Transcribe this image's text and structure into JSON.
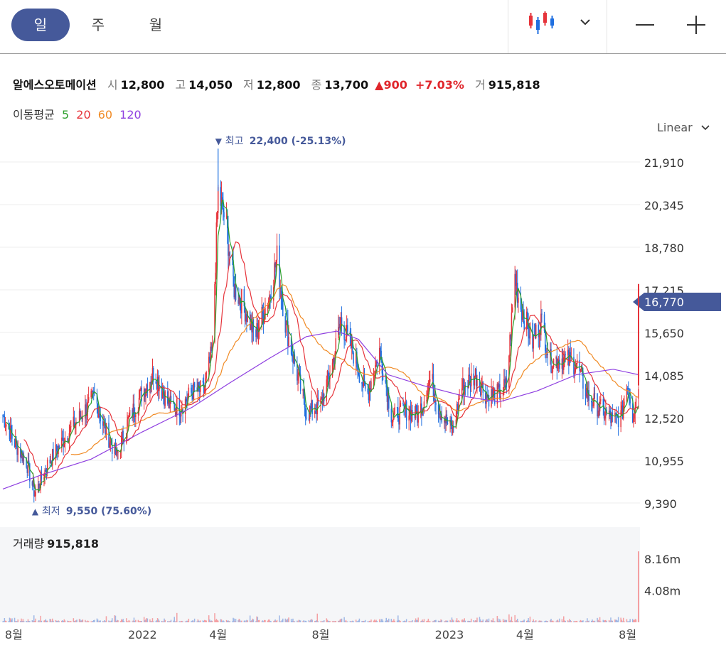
{
  "toolbar": {
    "tabs": [
      {
        "label": "일",
        "active": true
      },
      {
        "label": "주",
        "active": false
      },
      {
        "label": "월",
        "active": false
      }
    ],
    "chart_type_icon": "candlestick-icon",
    "dropdown_icon": "chevron-down-icon",
    "zoom_out_icon": "minus-icon",
    "zoom_in_icon": "plus-icon"
  },
  "info": {
    "name": "알에스오토메이션",
    "open_label": "시",
    "open": "12,800",
    "high_label": "고",
    "high": "14,050",
    "low_label": "저",
    "low": "12,800",
    "close_label": "종",
    "close": "13,700",
    "change": "900",
    "change_pct": "+7.03%",
    "volume_label": "거",
    "volume": "915,818"
  },
  "moving_avg": {
    "label": "이동평균",
    "periods": [
      {
        "label": "5",
        "color": "#2ca02c"
      },
      {
        "label": "20",
        "color": "#e6333a"
      },
      {
        "label": "60",
        "color": "#f08a24"
      },
      {
        "label": "120",
        "color": "#8e3ee0"
      }
    ]
  },
  "scale_mode": "Linear",
  "volume_header": {
    "label": "거래량",
    "value": "915,818"
  },
  "colors": {
    "up": "#e6333a",
    "down": "#1f6fe0",
    "accent": "#45599a",
    "ma5": "#2ca02c",
    "ma20": "#e6333a",
    "ma60": "#f08a24",
    "ma120": "#8e3ee0"
  },
  "chart_data": {
    "type": "candlestick",
    "y_ticks": [
      "21,910",
      "20,345",
      "18,780",
      "17,215",
      "15,650",
      "14,085",
      "12,520",
      "10,955",
      "9,390"
    ],
    "ylim": [
      9390,
      21910
    ],
    "x_ticks": [
      "8월",
      "2022",
      "4월",
      "8월",
      "2023",
      "4월",
      "8월"
    ],
    "current_price": "16,770",
    "high_marker": {
      "label": "최고",
      "value": "22,400",
      "pct": "(-25.13%)"
    },
    "low_marker": {
      "label": "최저",
      "value": "9,550",
      "pct": "(75.60%)"
    },
    "volume_ticks": [
      "8.16m",
      "4.08m"
    ],
    "last_volume": 915818,
    "close_points": [
      [
        "2021-07-19",
        12600
      ],
      [
        "2021-08-02",
        11600
      ],
      [
        "2021-08-16",
        10900
      ],
      [
        "2021-08-26",
        9700
      ],
      [
        "2021-09-10",
        10800
      ],
      [
        "2021-10-01",
        11800
      ],
      [
        "2021-10-20",
        12600
      ],
      [
        "2021-11-05",
        13300
      ],
      [
        "2021-11-15",
        12300
      ],
      [
        "2021-12-01",
        11100
      ],
      [
        "2021-12-15",
        12400
      ],
      [
        "2022-01-03",
        13600
      ],
      [
        "2022-01-15",
        14200
      ],
      [
        "2022-02-01",
        13000
      ],
      [
        "2022-02-15",
        12900
      ],
      [
        "2022-03-02",
        13500
      ],
      [
        "2022-03-15",
        13500
      ],
      [
        "2022-03-25",
        15000
      ],
      [
        "2022-04-01",
        20800
      ],
      [
        "2022-04-10",
        19700
      ],
      [
        "2022-04-20",
        17300
      ],
      [
        "2022-05-02",
        16600
      ],
      [
        "2022-05-15",
        15500
      ],
      [
        "2022-06-01",
        17000
      ],
      [
        "2022-06-10",
        18400
      ],
      [
        "2022-06-20",
        16000
      ],
      [
        "2022-07-01",
        14500
      ],
      [
        "2022-07-15",
        12700
      ],
      [
        "2022-08-01",
        13000
      ],
      [
        "2022-08-15",
        14500
      ],
      [
        "2022-08-25",
        16100
      ],
      [
        "2022-09-10",
        14800
      ],
      [
        "2022-09-25",
        13300
      ],
      [
        "2022-10-10",
        15000
      ],
      [
        "2022-10-25",
        12500
      ],
      [
        "2022-11-10",
        12800
      ],
      [
        "2022-11-25",
        12600
      ],
      [
        "2022-12-10",
        14000
      ],
      [
        "2022-12-20",
        12800
      ],
      [
        "2023-01-05",
        12000
      ],
      [
        "2023-01-15",
        13600
      ],
      [
        "2023-02-01",
        14100
      ],
      [
        "2023-02-15",
        13300
      ],
      [
        "2023-03-01",
        13400
      ],
      [
        "2023-03-10",
        13700
      ],
      [
        "2023-03-20",
        17700
      ],
      [
        "2023-03-25",
        16800
      ],
      [
        "2023-04-10",
        15300
      ],
      [
        "2023-04-20",
        16100
      ],
      [
        "2023-05-01",
        14600
      ],
      [
        "2023-05-15",
        14700
      ],
      [
        "2023-06-01",
        14500
      ],
      [
        "2023-06-15",
        13300
      ],
      [
        "2023-07-01",
        12800
      ],
      [
        "2023-07-15",
        12400
      ],
      [
        "2023-07-25",
        12600
      ],
      [
        "2023-08-01",
        13900
      ],
      [
        "2023-08-07",
        12600
      ],
      [
        "2023-08-14",
        13700
      ]
    ],
    "ma120_points": [
      [
        "2021-07-19",
        9900
      ],
      [
        "2021-09-01",
        10400
      ],
      [
        "2021-11-01",
        11000
      ],
      [
        "2022-01-01",
        12000
      ],
      [
        "2022-03-01",
        12900
      ],
      [
        "2022-04-15",
        13800
      ],
      [
        "2022-06-01",
        14700
      ],
      [
        "2022-07-15",
        15500
      ],
      [
        "2022-08-20",
        15700
      ],
      [
        "2022-09-15",
        15400
      ],
      [
        "2022-10-20",
        14100
      ],
      [
        "2022-12-01",
        13700
      ],
      [
        "2023-01-20",
        13300
      ],
      [
        "2023-03-01",
        13100
      ],
      [
        "2023-04-15",
        13500
      ],
      [
        "2023-06-01",
        14100
      ],
      [
        "2023-07-15",
        14300
      ],
      [
        "2023-08-14",
        14100
      ]
    ]
  }
}
